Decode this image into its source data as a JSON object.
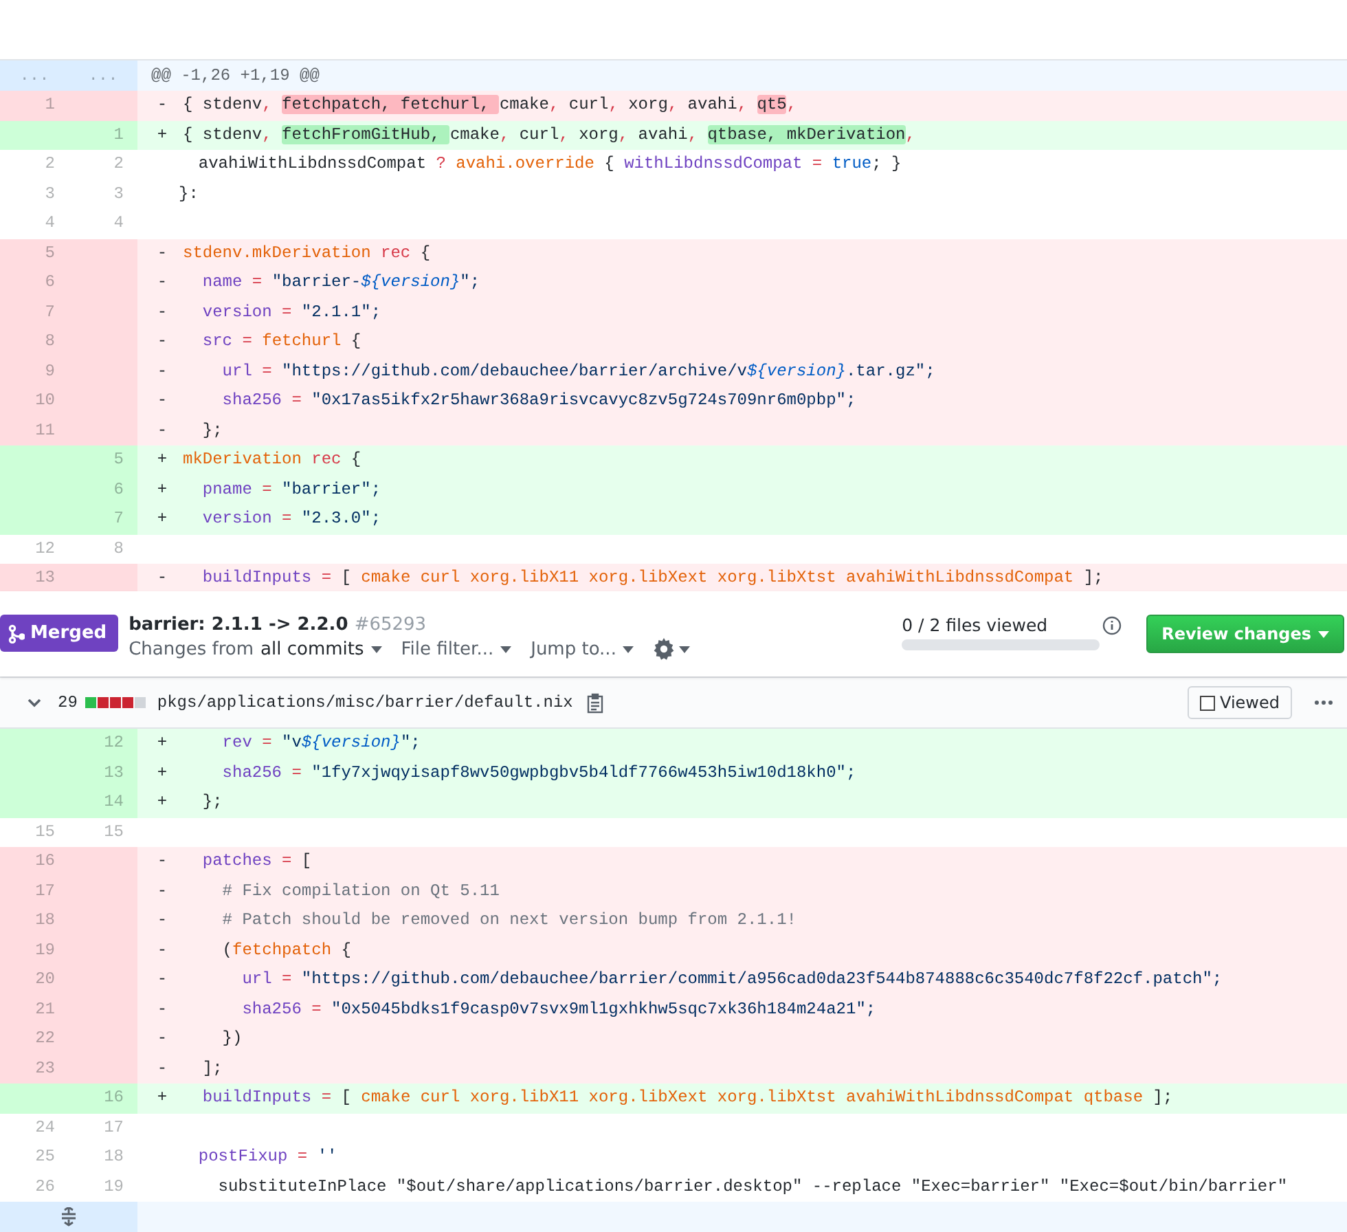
{
  "top_diff": {
    "rows": [
      {
        "kind": "hunk",
        "old": "...",
        "new": "...",
        "code": [
          {
            "t": "@@ -1,26 +1,19 @@",
            "kind": "plain"
          }
        ]
      },
      {
        "kind": "del",
        "old": "1",
        "sign": "-",
        "code": [
          {
            "t": "{ stdenv",
            "kind": "plain"
          },
          {
            "t": ", ",
            "kind": "operator"
          },
          {
            "t": "fetchpatch, fetchurl, ",
            "kind": "changed"
          },
          {
            "t": "cmake",
            "kind": "plain"
          },
          {
            "t": ",",
            "kind": "operator"
          },
          {
            "t": " curl",
            "kind": "plain"
          },
          {
            "t": ",",
            "kind": "operator"
          },
          {
            "t": " xorg",
            "kind": "plain"
          },
          {
            "t": ",",
            "kind": "operator"
          },
          {
            "t": " avahi",
            "kind": "plain"
          },
          {
            "t": ", ",
            "kind": "operator"
          },
          {
            "t": "qt5",
            "kind": "changed"
          },
          {
            "t": ",",
            "kind": "operator"
          }
        ]
      },
      {
        "kind": "add",
        "new": "1",
        "sign": "+",
        "code": [
          {
            "t": "{ stdenv",
            "kind": "plain"
          },
          {
            "t": ", ",
            "kind": "operator"
          },
          {
            "t": "fetchFromGitHub, ",
            "kind": "changed"
          },
          {
            "t": "cmake",
            "kind": "plain"
          },
          {
            "t": ",",
            "kind": "operator"
          },
          {
            "t": " curl",
            "kind": "plain"
          },
          {
            "t": ",",
            "kind": "operator"
          },
          {
            "t": " xorg",
            "kind": "plain"
          },
          {
            "t": ",",
            "kind": "operator"
          },
          {
            "t": " avahi",
            "kind": "plain"
          },
          {
            "t": ", ",
            "kind": "operator"
          },
          {
            "t": "qtbase, mkDerivation",
            "kind": "changed"
          },
          {
            "t": ",",
            "kind": "operator"
          }
        ]
      },
      {
        "kind": "ctx",
        "old": "2",
        "new": "2",
        "code": [
          {
            "t": "  avahiWithLibdnssdCompat ",
            "kind": "plain"
          },
          {
            "t": "? ",
            "kind": "operator"
          },
          {
            "t": "avahi.override",
            "kind": "function"
          },
          {
            "t": " { ",
            "kind": "plain"
          },
          {
            "t": "withLibdnssdCompat ",
            "kind": "attribute"
          },
          {
            "t": "= ",
            "kind": "operator"
          },
          {
            "t": "true",
            "kind": "boolean"
          },
          {
            "t": "; }",
            "kind": "plain"
          }
        ]
      },
      {
        "kind": "ctx",
        "old": "3",
        "new": "3",
        "code": [
          {
            "t": "}:",
            "kind": "plain"
          }
        ]
      },
      {
        "kind": "ctx",
        "old": "4",
        "new": "4",
        "code": []
      },
      {
        "kind": "del",
        "old": "5",
        "sign": "-",
        "code": [
          {
            "t": "stdenv.mkDerivation ",
            "kind": "function"
          },
          {
            "t": "rec",
            "kind": "operator"
          },
          {
            "t": " {",
            "kind": "plain"
          }
        ]
      },
      {
        "kind": "del",
        "old": "6",
        "sign": "-",
        "code": [
          {
            "t": "  name ",
            "kind": "attribute"
          },
          {
            "t": "=",
            "kind": "operator"
          },
          {
            "t": " \"barrier-",
            "kind": "string"
          },
          {
            "t": "${version}",
            "kind": "interpolation"
          },
          {
            "t": "\";",
            "kind": "string"
          }
        ]
      },
      {
        "kind": "del",
        "old": "7",
        "sign": "-",
        "code": [
          {
            "t": "  version ",
            "kind": "attribute"
          },
          {
            "t": "=",
            "kind": "operator"
          },
          {
            "t": " \"2.1.1\";",
            "kind": "string"
          }
        ]
      },
      {
        "kind": "del",
        "old": "8",
        "sign": "-",
        "code": [
          {
            "t": "  src ",
            "kind": "attribute"
          },
          {
            "t": "= ",
            "kind": "operator"
          },
          {
            "t": "fetchurl",
            "kind": "function"
          },
          {
            "t": " {",
            "kind": "plain"
          }
        ]
      },
      {
        "kind": "del",
        "old": "9",
        "sign": "-",
        "code": [
          {
            "t": "    url ",
            "kind": "attribute"
          },
          {
            "t": "=",
            "kind": "operator"
          },
          {
            "t": " \"https://github.com/debauchee/barrier/archive/v",
            "kind": "string"
          },
          {
            "t": "${version}",
            "kind": "interpolation"
          },
          {
            "t": ".tar.gz\";",
            "kind": "string"
          }
        ]
      },
      {
        "kind": "del",
        "old": "10",
        "sign": "-",
        "code": [
          {
            "t": "    sha256 ",
            "kind": "attribute"
          },
          {
            "t": "=",
            "kind": "operator"
          },
          {
            "t": " \"0x17as5ikfx2r5hawr368a9risvcavyc8zv5g724s709nr6m0pbp\";",
            "kind": "string"
          }
        ]
      },
      {
        "kind": "del",
        "old": "11",
        "sign": "-",
        "code": [
          {
            "t": "  };",
            "kind": "plain"
          }
        ]
      },
      {
        "kind": "add",
        "new": "5",
        "sign": "+",
        "code": [
          {
            "t": "mkDerivation ",
            "kind": "function"
          },
          {
            "t": "rec",
            "kind": "operator"
          },
          {
            "t": " {",
            "kind": "plain"
          }
        ]
      },
      {
        "kind": "add",
        "new": "6",
        "sign": "+",
        "code": [
          {
            "t": "  pname ",
            "kind": "attribute"
          },
          {
            "t": "=",
            "kind": "operator"
          },
          {
            "t": " \"barrier\";",
            "kind": "string"
          }
        ]
      },
      {
        "kind": "add",
        "new": "7",
        "sign": "+",
        "code": [
          {
            "t": "  version ",
            "kind": "attribute"
          },
          {
            "t": "=",
            "kind": "operator"
          },
          {
            "t": " \"2.3.0\";",
            "kind": "string"
          }
        ]
      },
      {
        "kind": "ctx",
        "old": "12",
        "new": "8",
        "code": []
      },
      {
        "kind": "del",
        "old": "13",
        "sign": "-",
        "code": [
          {
            "t": "  buildInputs ",
            "kind": "attribute"
          },
          {
            "t": "=",
            "kind": "operator"
          },
          {
            "t": " [ ",
            "kind": "plain"
          },
          {
            "t": "cmake curl xorg.libX11 xorg.libXext xorg.libXtst avahiWithLibdnssdCompat",
            "kind": "function"
          },
          {
            "t": " ];",
            "kind": "plain"
          }
        ]
      }
    ]
  },
  "pr_header": {
    "status": "Merged",
    "title": "barrier: 2.1.1 -> 2.2.0",
    "number": "#65293",
    "toolbar": [
      {
        "kind": "menu",
        "label": "Changes from ",
        "strong": "all commits"
      },
      {
        "kind": "menu",
        "label": "File filter..."
      },
      {
        "kind": "menu",
        "label": "Jump to..."
      },
      {
        "kind": "gear"
      }
    ],
    "files_viewed": {
      "label": "0 / 2 files viewed",
      "level": 0
    },
    "review_button": "Review changes"
  },
  "file_header": {
    "expanded": true,
    "changes": "29",
    "diffstat": [
      {
        "color": "#2cbe4e"
      },
      {
        "color": "#cb2431"
      },
      {
        "color": "#cb2431"
      },
      {
        "color": "#cb2431"
      },
      {
        "color": "#d1d5da"
      }
    ],
    "path": "pkgs/applications/misc/barrier/default.nix",
    "viewed": {
      "label": "Viewed",
      "checked": false
    }
  },
  "bottom_diff": {
    "rows": [
      {
        "kind": "add",
        "new": "12",
        "sign": "+",
        "code": [
          {
            "t": "    rev ",
            "kind": "attribute"
          },
          {
            "t": "=",
            "kind": "operator"
          },
          {
            "t": " \"v",
            "kind": "string"
          },
          {
            "t": "${version}",
            "kind": "interpolation"
          },
          {
            "t": "\";",
            "kind": "string"
          }
        ]
      },
      {
        "kind": "add",
        "new": "13",
        "sign": "+",
        "code": [
          {
            "t": "    sha256 ",
            "kind": "attribute"
          },
          {
            "t": "=",
            "kind": "operator"
          },
          {
            "t": " \"1fy7xjwqyisapf8wv50gwpbgbv5b4ldf7766w453h5iw10d18kh0\";",
            "kind": "string"
          }
        ]
      },
      {
        "kind": "add",
        "new": "14",
        "sign": "+",
        "code": [
          {
            "t": "  };",
            "kind": "plain"
          }
        ]
      },
      {
        "kind": "ctx",
        "old": "15",
        "new": "15",
        "code": []
      },
      {
        "kind": "del",
        "old": "16",
        "sign": "-",
        "code": [
          {
            "t": "  patches ",
            "kind": "attribute"
          },
          {
            "t": "=",
            "kind": "operator"
          },
          {
            "t": " [",
            "kind": "plain"
          }
        ]
      },
      {
        "kind": "del",
        "old": "17",
        "sign": "-",
        "code": [
          {
            "t": "    # Fix compilation on Qt 5.11",
            "kind": "comment"
          }
        ]
      },
      {
        "kind": "del",
        "old": "18",
        "sign": "-",
        "code": [
          {
            "t": "    # Patch should be removed on next version bump from 2.1.1!",
            "kind": "comment"
          }
        ]
      },
      {
        "kind": "del",
        "old": "19",
        "sign": "-",
        "code": [
          {
            "t": "    (",
            "kind": "plain"
          },
          {
            "t": "fetchpatch",
            "kind": "function"
          },
          {
            "t": " {",
            "kind": "plain"
          }
        ]
      },
      {
        "kind": "del",
        "old": "20",
        "sign": "-",
        "code": [
          {
            "t": "      url ",
            "kind": "attribute"
          },
          {
            "t": "=",
            "kind": "operator"
          },
          {
            "t": " \"https://github.com/debauchee/barrier/commit/a956cad0da23f544b874888c6c3540dc7f8f22cf.patch\";",
            "kind": "string"
          }
        ]
      },
      {
        "kind": "del",
        "old": "21",
        "sign": "-",
        "code": [
          {
            "t": "      sha256 ",
            "kind": "attribute"
          },
          {
            "t": "=",
            "kind": "operator"
          },
          {
            "t": " \"0x5045bdks1f9casp0v7svx9ml1gxhkhw5sqc7xk36h184m24a21\";",
            "kind": "string"
          }
        ]
      },
      {
        "kind": "del",
        "old": "22",
        "sign": "-",
        "code": [
          {
            "t": "    })",
            "kind": "plain"
          }
        ]
      },
      {
        "kind": "del",
        "old": "23",
        "sign": "-",
        "code": [
          {
            "t": "  ];",
            "kind": "plain"
          }
        ]
      },
      {
        "kind": "add",
        "new": "16",
        "sign": "+",
        "code": [
          {
            "t": "  buildInputs ",
            "kind": "attribute"
          },
          {
            "t": "=",
            "kind": "operator"
          },
          {
            "t": " [ ",
            "kind": "plain"
          },
          {
            "t": "cmake curl xorg.libX11 xorg.libXext xorg.libXtst avahiWithLibdnssdCompat qtbase",
            "kind": "function"
          },
          {
            "t": " ];",
            "kind": "plain"
          }
        ]
      },
      {
        "kind": "ctx",
        "old": "24",
        "new": "17",
        "code": []
      },
      {
        "kind": "ctx",
        "old": "25",
        "new": "18",
        "code": [
          {
            "t": "  postFixup ",
            "kind": "attribute"
          },
          {
            "t": "=",
            "kind": "operator"
          },
          {
            "t": " ''",
            "kind": "string"
          }
        ]
      },
      {
        "kind": "ctx",
        "old": "26",
        "new": "19",
        "code": [
          {
            "t": "    substituteInPlace \"$out/share/applications/barrier.desktop\" --replace \"Exec=barrier\" \"Exec=$out/bin/barrier\"",
            "kind": "plain"
          }
        ]
      },
      {
        "kind": "expand"
      }
    ]
  }
}
